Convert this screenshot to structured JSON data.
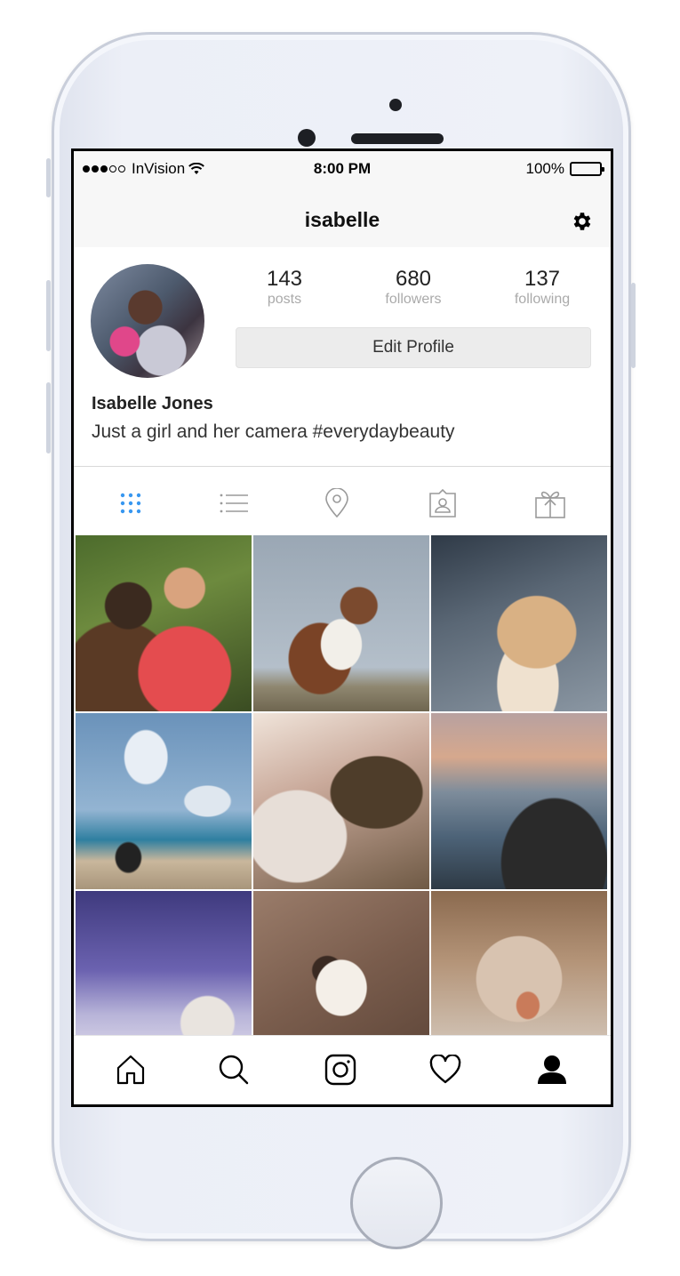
{
  "status_bar": {
    "carrier": "InVision",
    "time": "8:00 PM",
    "battery": "100%"
  },
  "nav": {
    "title": "isabelle",
    "settings_icon": "gear-icon"
  },
  "profile": {
    "stats": [
      {
        "value": "143",
        "label": "posts"
      },
      {
        "value": "680",
        "label": "followers"
      },
      {
        "value": "137",
        "label": "following"
      }
    ],
    "edit_button": "Edit Profile",
    "name": "Isabelle Jones",
    "bio": "Just a girl and her camera #everydaybeauty"
  },
  "tabs": [
    {
      "icon": "grid-icon",
      "active": true
    },
    {
      "icon": "list-icon",
      "active": false
    },
    {
      "icon": "location-pin-icon",
      "active": false
    },
    {
      "icon": "tagged-person-icon",
      "active": false
    },
    {
      "icon": "gift-icon",
      "active": false
    }
  ],
  "colors": {
    "accent": "#3897f0",
    "inactive_icon": "#9a9a9a",
    "text": "#222222"
  },
  "photos": [
    "two-women-laughing",
    "corgi-on-rock",
    "spaniel-lying",
    "beach-scooter",
    "rock-closeup",
    "sunset-coast",
    "arctic-fox-snow",
    "puppy-sleeping",
    "cat-closeup"
  ],
  "tab_bar": [
    {
      "icon": "home-icon",
      "active": false
    },
    {
      "icon": "search-icon",
      "active": false
    },
    {
      "icon": "camera-icon",
      "active": false
    },
    {
      "icon": "heart-icon",
      "active": false
    },
    {
      "icon": "profile-icon",
      "active": true
    }
  ]
}
